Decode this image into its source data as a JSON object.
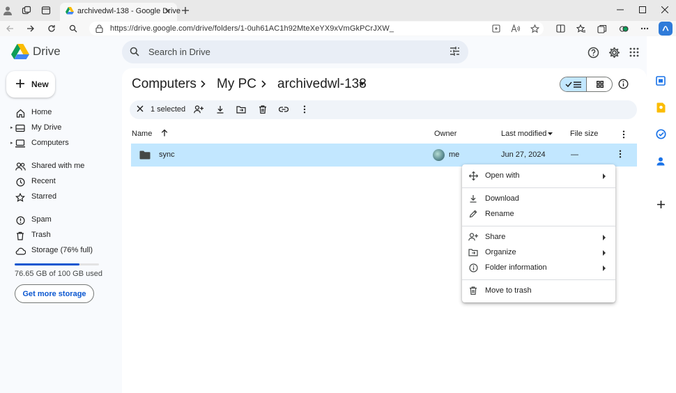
{
  "browser": {
    "tab_title": "archivedwl-138 - Google Drive",
    "url": "https://drive.google.com/drive/folders/1-0uh61AC1h92MteXeYX9xVmGkPCrJXW_"
  },
  "drive": {
    "brand": "Drive",
    "search_placeholder": "Search in Drive",
    "new_label": "New",
    "nav": {
      "home": "Home",
      "my_drive": "My Drive",
      "computers": "Computers",
      "shared": "Shared with me",
      "recent": "Recent",
      "starred": "Starred",
      "spam": "Spam",
      "trash": "Trash",
      "storage": "Storage (76% full)"
    },
    "storage": {
      "used_fraction": 0.7665,
      "text": "76.65 GB of 100 GB used",
      "button": "Get more storage"
    },
    "breadcrumb": [
      "Computers",
      "My PC",
      "archivedwl-138"
    ],
    "selection": "1 selected",
    "columns": {
      "name": "Name",
      "owner": "Owner",
      "modified": "Last modified",
      "size": "File size"
    },
    "rows": [
      {
        "name": "sync",
        "owner": "me",
        "modified": "Jun 27, 2024",
        "size": "—"
      }
    ],
    "context_menu": {
      "open_with": "Open with",
      "download": "Download",
      "rename": "Rename",
      "share": "Share",
      "organize": "Organize",
      "folder_info": "Folder information",
      "move_trash": "Move to trash"
    }
  },
  "colors": {
    "accent": "#0b57d0",
    "selected_row": "#c2e7ff",
    "search_bg": "#e9eef6",
    "app_bg": "#f8fafd"
  }
}
